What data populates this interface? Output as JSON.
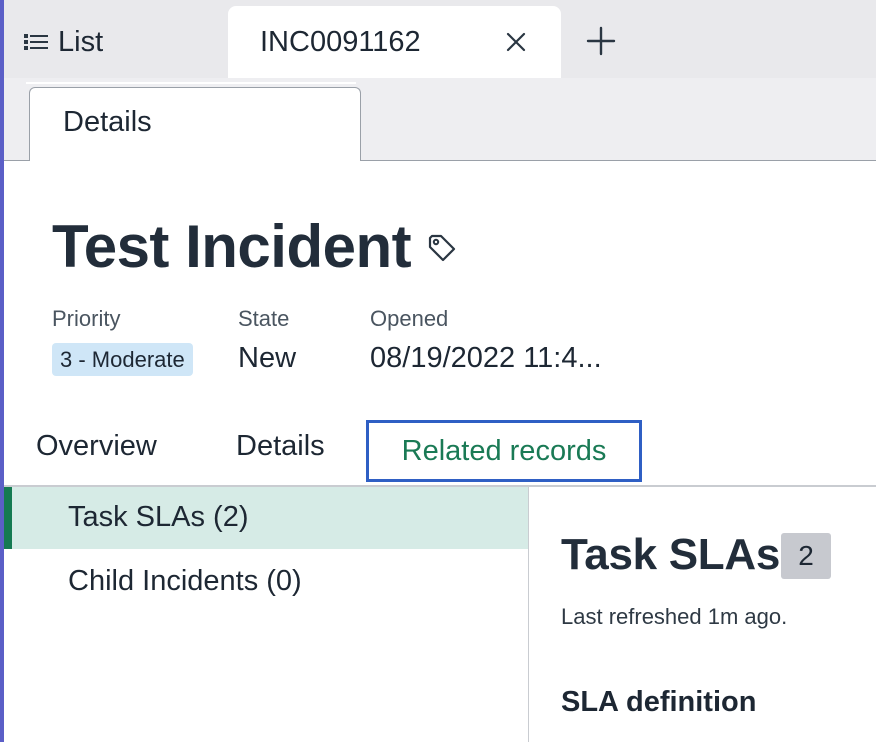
{
  "workspace_tabs": {
    "list_label": "List",
    "record_tab_label": "INC0091162"
  },
  "sub_tab": {
    "label": "Details"
  },
  "record": {
    "title": "Test Incident",
    "fields": {
      "priority_label": "Priority",
      "priority_value": "3 - Moderate",
      "state_label": "State",
      "state_value": "New",
      "opened_label": "Opened",
      "opened_value": "08/19/2022 11:4..."
    }
  },
  "record_tabs": [
    {
      "label": "Overview"
    },
    {
      "label": "Details"
    },
    {
      "label": "Related records",
      "active": true
    }
  ],
  "related_lists": [
    {
      "label": "Task SLAs (2)",
      "selected": true
    },
    {
      "label": "Child Incidents (0)"
    }
  ],
  "panel": {
    "title": "Task SLAs",
    "count": "2",
    "refreshed_text": "Last refreshed 1m ago.",
    "column_heading": "SLA definition"
  },
  "colors": {
    "accent_left_bar": "#5b5fc7",
    "active_tab_text": "#1a7a55",
    "focus_outline": "#2f5fc4",
    "selected_nav_bg": "#d6ebe6",
    "selected_nav_marker": "#157a52",
    "priority_badge_bg": "#cfe6f7"
  },
  "icons": [
    "list-icon",
    "close-icon",
    "plus-icon",
    "tag-icon"
  ]
}
